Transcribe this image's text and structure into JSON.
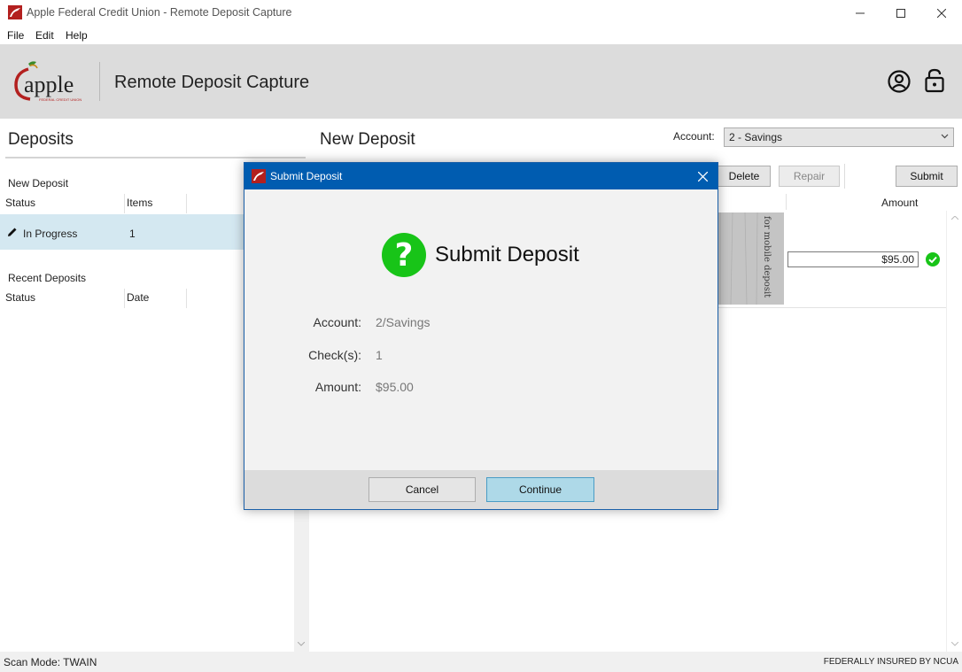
{
  "window": {
    "title": "Apple Federal Credit Union - Remote Deposit Capture"
  },
  "menu": [
    "File",
    "Edit",
    "Help"
  ],
  "header": {
    "logo_text": "apple",
    "logo_subtext": "FEDERAL CREDIT UNION",
    "app_title": "Remote Deposit Capture",
    "icons": [
      "user-icon",
      "lock-icon"
    ]
  },
  "deposits_panel": {
    "heading": "Deposits",
    "new_deposit_label": "New Deposit",
    "new_deposit_columns": [
      "Status",
      "Items"
    ],
    "new_deposit_rows": [
      {
        "status": "In Progress",
        "items": "1",
        "icon": "pencil-icon"
      }
    ],
    "recent_label": "Recent Deposits",
    "recent_columns": [
      "Status",
      "Date"
    ]
  },
  "new_deposit_panel": {
    "heading": "New Deposit",
    "account_label": "Account:",
    "account_value": "2 - Savings",
    "buttons": {
      "delete": "Delete",
      "repair": "Repair",
      "submit": "Submit"
    },
    "amount_column": "Amount",
    "items": [
      {
        "amount": "$95.00",
        "status_icon": "check-circle-icon",
        "endorsement": "for mobile deposit"
      }
    ]
  },
  "status_bar": {
    "scan_mode": "Scan Mode: TWAIN",
    "insured": "FEDERALLY INSURED BY NCUA"
  },
  "modal": {
    "title": "Submit Deposit",
    "headline": "Submit Deposit",
    "fields": [
      {
        "label": "Account:",
        "value": "2/Savings"
      },
      {
        "label": "Check(s):",
        "value": "1"
      },
      {
        "label": "Amount:",
        "value": "$95.00"
      }
    ],
    "cancel_label": "Cancel",
    "continue_label": "Continue"
  },
  "colors": {
    "modal_titlebar": "#005cb0",
    "success_green": "#18c418",
    "selected_row": "#d4e8f1",
    "primary_button": "#aed9e8",
    "brand_red": "#b3201f"
  }
}
